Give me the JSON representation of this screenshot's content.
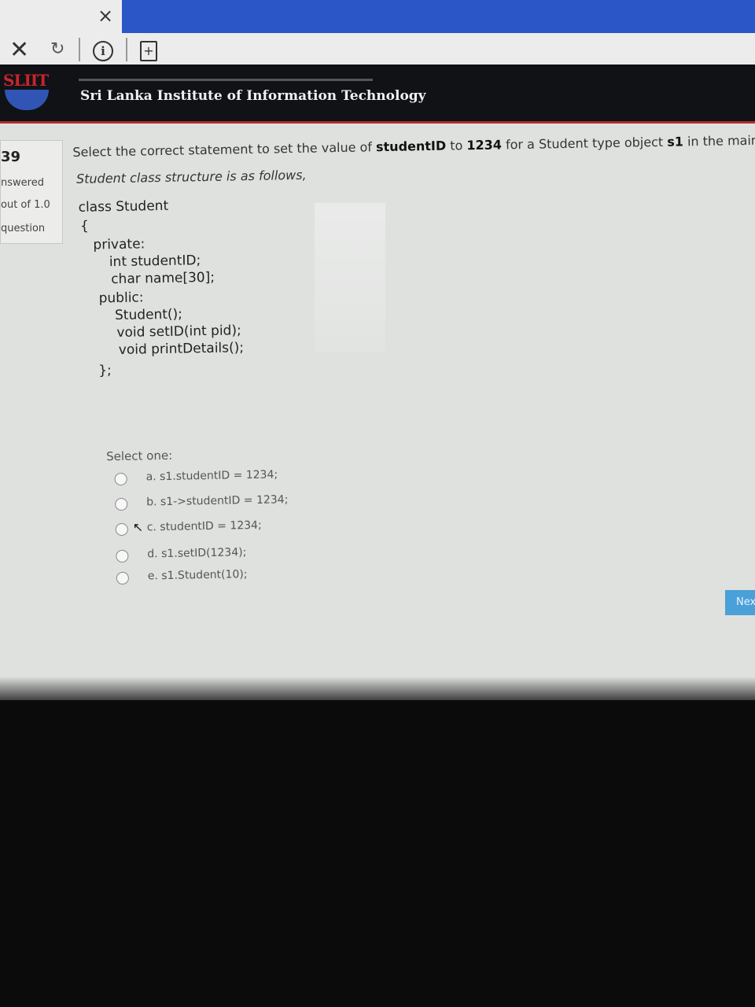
{
  "browser": {
    "tab_close": "×",
    "stop": "✕",
    "reload": "↻",
    "info": "i",
    "save": "+"
  },
  "header": {
    "logo_text": "SLIIT",
    "title": "Sri Lanka Institute of Information Technology"
  },
  "info_panel": {
    "number": "39",
    "state": "nswered",
    "marks": "out of 1.0",
    "flag": "question"
  },
  "question": {
    "text_1": "Select the correct statement to set the value of ",
    "text_bold_1": "studentID",
    "text_2": " to ",
    "text_bold_2": "1234",
    "text_3": " for a Student type object ",
    "text_bold_3": "s1",
    "text_4": " in the main program",
    "subtitle": "Student class structure is as follows,",
    "code": {
      "line1": "class Student",
      "line2": "{",
      "line3": "private:",
      "line4": "int studentID;",
      "line5": "char name[30];",
      "line6": "public:",
      "line7": "Student();",
      "line8": "void setID(int pid);",
      "line9": "void printDetails();",
      "line10": "};"
    }
  },
  "answer": {
    "prompt": "Select one:",
    "options": [
      {
        "label": "a. s1.studentID = 1234;"
      },
      {
        "label": "b. s1->studentID = 1234;"
      },
      {
        "label": "c. studentID = 1234;"
      },
      {
        "label": "d. s1.setID(1234);"
      },
      {
        "label": "e. s1.Student(10);"
      }
    ]
  },
  "next_label": "Nex"
}
